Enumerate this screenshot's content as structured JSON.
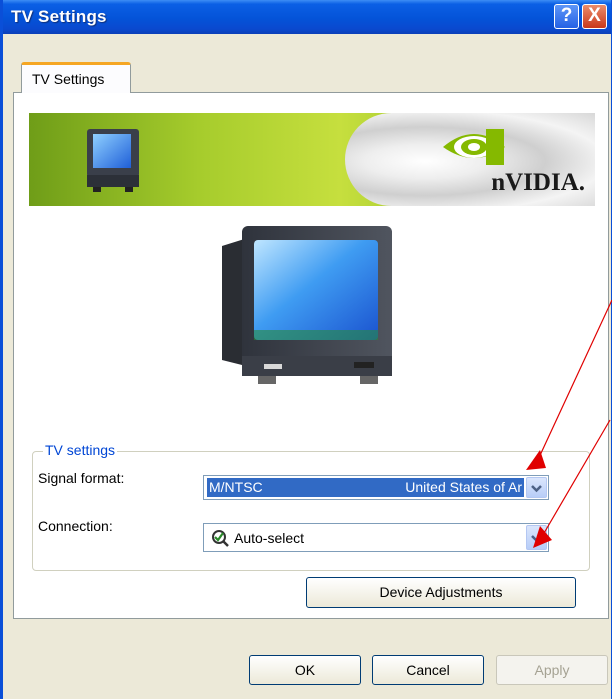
{
  "window": {
    "title": "TV Settings"
  },
  "titlebar": {
    "help_glyph": "?",
    "close_glyph": "X"
  },
  "tabs": [
    {
      "label": "TV Settings",
      "active": true
    }
  ],
  "banner": {
    "brand": "nVIDIA."
  },
  "group": {
    "title": "TV settings"
  },
  "signal_format": {
    "label": "Signal format:",
    "value_code": "M/NTSC",
    "value_region": "United States of Ar"
  },
  "connection": {
    "label": "Connection:",
    "value": "Auto-select"
  },
  "buttons": {
    "device_adjustments": "Device Adjustments",
    "ok": "OK",
    "cancel": "Cancel",
    "apply": "Apply"
  },
  "icons": [
    "help-icon",
    "close-icon",
    "tv-monitor-icon",
    "nvidia-eye-icon",
    "dropdown-arrow-icon",
    "connection-check-icon"
  ],
  "colors": {
    "titlebar": "#0453d8",
    "selection": "#316ac5",
    "group_title": "#0046d5",
    "annotation_arrow": "#e00000"
  }
}
